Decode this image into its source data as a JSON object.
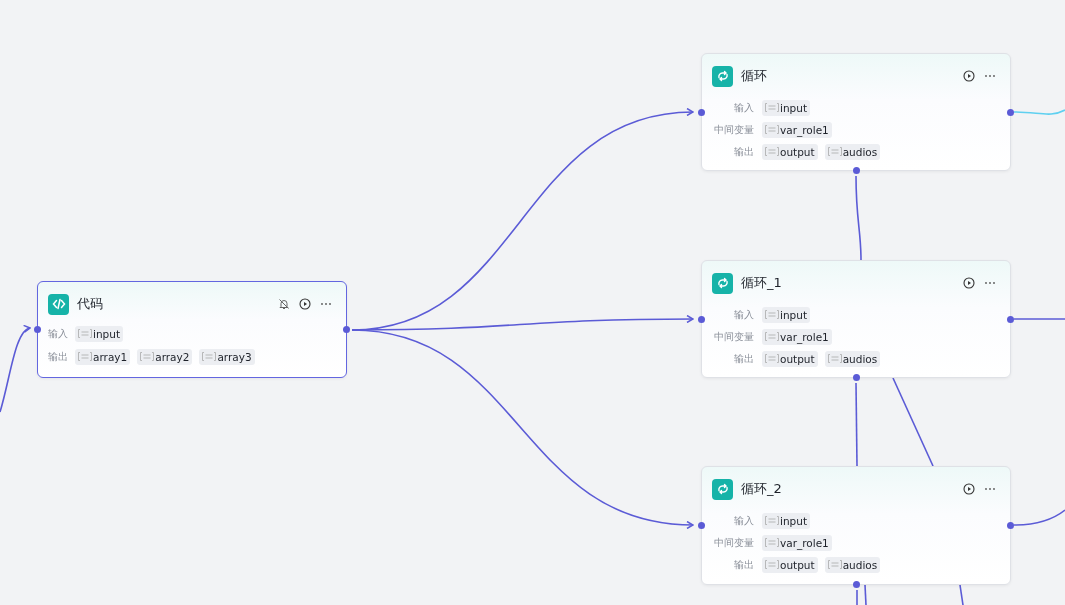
{
  "nodes": [
    {
      "kind": "code",
      "title": "代码",
      "selected": true,
      "bell_off": true,
      "rows": [
        {
          "label": "输入",
          "params": [
            "input"
          ]
        },
        {
          "label": "输出",
          "params": [
            "array1",
            "array2",
            "array3"
          ]
        }
      ]
    },
    {
      "kind": "loop",
      "title": "循环",
      "selected": false,
      "bell_off": false,
      "rows": [
        {
          "label": "输入",
          "params": [
            "input"
          ]
        },
        {
          "label": "中间变量",
          "params": [
            "var_role1"
          ]
        },
        {
          "label": "输出",
          "params": [
            "output",
            "audios"
          ]
        }
      ]
    },
    {
      "kind": "loop",
      "title": "循环_1",
      "selected": false,
      "bell_off": false,
      "rows": [
        {
          "label": "输入",
          "params": [
            "input"
          ]
        },
        {
          "label": "中间变量",
          "params": [
            "var_role1"
          ]
        },
        {
          "label": "输出",
          "params": [
            "output",
            "audios"
          ]
        }
      ]
    },
    {
      "kind": "loop",
      "title": "循环_2",
      "selected": false,
      "bell_off": false,
      "rows": [
        {
          "label": "输入",
          "params": [
            "input"
          ]
        },
        {
          "label": "中间变量",
          "params": [
            "var_role1"
          ]
        },
        {
          "label": "输出",
          "params": [
            "output",
            "audios"
          ]
        }
      ]
    }
  ]
}
